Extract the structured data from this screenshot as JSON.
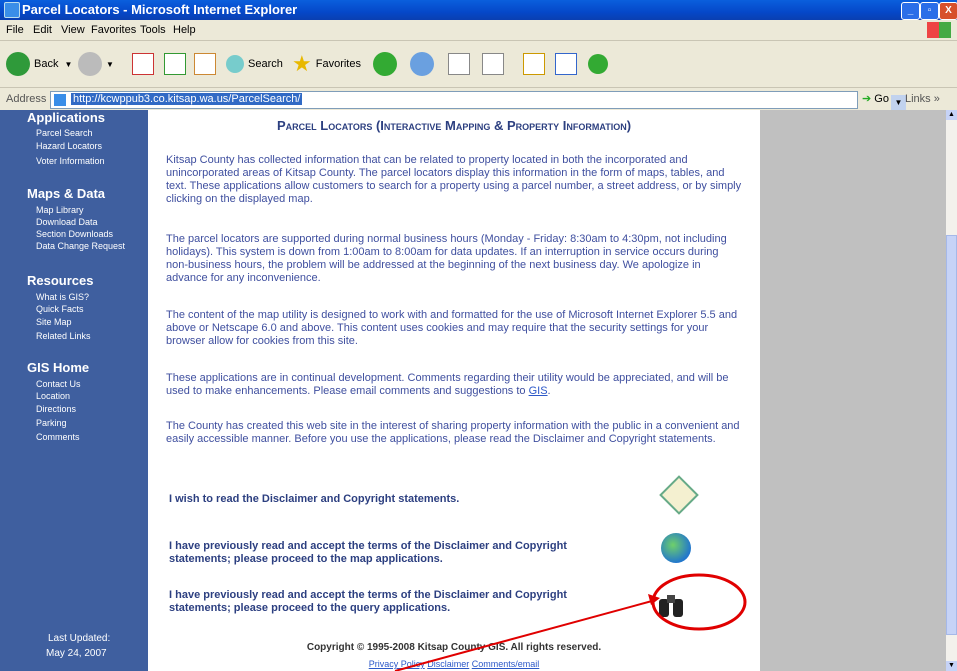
{
  "window": {
    "title": "Parcel Locators - Microsoft Internet Explorer",
    "min": "_",
    "max": "▫",
    "close": "X"
  },
  "menu": {
    "file": "File",
    "edit": "Edit",
    "view": "View",
    "favorites": "Favorites",
    "tools": "Tools",
    "help": "Help"
  },
  "toolbar": {
    "back": "Back",
    "search": "Search",
    "favorites": "Favorites"
  },
  "address": {
    "label": "Address",
    "url": "http://kcwppub3.co.kitsap.wa.us/ParcelSearch/",
    "go": "Go",
    "links": "Links"
  },
  "sidebar": {
    "applications": {
      "title": "Applications",
      "items": [
        "Parcel Search",
        "Hazard Locators",
        "Voter Information"
      ]
    },
    "maps": {
      "title": "Maps & Data",
      "items": [
        "Map Library",
        "Download Data",
        "Section Downloads",
        "Data Change Request"
      ]
    },
    "resources": {
      "title": "Resources",
      "items": [
        "What is GIS?",
        "Quick Facts",
        "Site Map",
        "Related Links"
      ]
    },
    "gishome": {
      "title": "GIS Home",
      "items": [
        "Contact Us",
        "Location",
        "Directions",
        "Parking",
        "Comments"
      ]
    },
    "updated_label": "Last Updated:",
    "updated_date": "May 24, 2007"
  },
  "main": {
    "heading": "Parcel Locators (Interactive Mapping & Property Information)",
    "p1": "Kitsap County has collected information that can be related to property located in both the incorporated and unincorporated areas of Kitsap County. The parcel locators display this information in the form of maps, tables, and text. These applications allow customers to search for a property using a parcel number, a street address, or by simply clicking on the displayed map.",
    "p2": "The parcel locators are supported during normal business hours (Monday - Friday: 8:30am to 4:30pm, not including holidays). This system is down from 1:00am to 8:00am for data updates. If an interruption in service occurs during non-business hours, the problem will be addressed at the beginning of the next business day. We apologize in advance for any inconvenience.",
    "p3": "The content of the map utility is designed to work with and formatted for the use of Microsoft Internet Explorer 5.5 and above or Netscape 6.0 and above. This content uses cookies and may require that the security settings for your browser allow for cookies from this site.",
    "p4_pre": "These applications are in continual development. Comments regarding their utility would be appreciated, and will be used to make enhancements. Please email comments and suggestions to ",
    "p4_link": "GIS",
    "p4_post": ".",
    "p5": "The County has created this web site in the interest of sharing property information with the public in a convenient and easily accessible manner. Before you use the applications, please read the Disclaimer and Copyright statements.",
    "action1": "I wish to read the Disclaimer and Copyright statements.",
    "action2": "I have previously read and accept the terms of the Disclaimer and Copyright statements; please proceed to the map applications.",
    "action3": "I have previously read and accept the terms of the Disclaimer and Copyright statements; please proceed to the query applications.",
    "copyright": "Copyright © 1995-2008 Kitsap County GIS. All rights reserved.",
    "privacy": "Privacy Policy",
    "disclaimer": "Disclaimer",
    "comments": "Comments/email"
  },
  "annotation_color": "#e00000"
}
